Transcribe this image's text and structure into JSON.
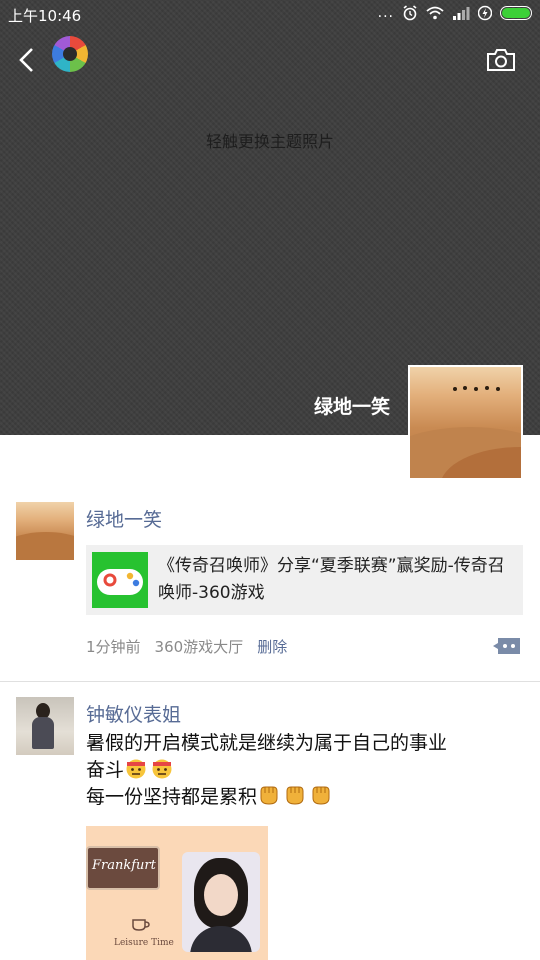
{
  "status_bar": {
    "time": "上午10:46",
    "dots": "...",
    "battery_color": "#3cd038"
  },
  "header": {
    "back_icon": "chevron-left-icon",
    "logo_icon": "aperture-logo-icon",
    "camera_icon": "camera-icon"
  },
  "cover": {
    "hint": "轻触更换主题照片",
    "owner_name": "绿地一笑"
  },
  "posts": [
    {
      "author": "绿地一笑",
      "share": {
        "title": "《传奇召唤师》分享“夏季联赛”赢奖励-传奇召唤师-360游戏",
        "icon": "gamepad-icon"
      },
      "time": "1分钟前",
      "source": "360游戏大厅",
      "delete_label": "删除"
    },
    {
      "author": "钟敏仪表姐",
      "line1": "暑假的开启模式就是继续为属于自己的事业",
      "line2": "奋斗",
      "line3": "每一份坚持都是累积",
      "image_text": {
        "sign": "Frankfurt",
        "sub": "Leisure Time"
      }
    }
  ],
  "colors": {
    "link": "#576b95",
    "cover_bg": "#3d3d3d"
  }
}
